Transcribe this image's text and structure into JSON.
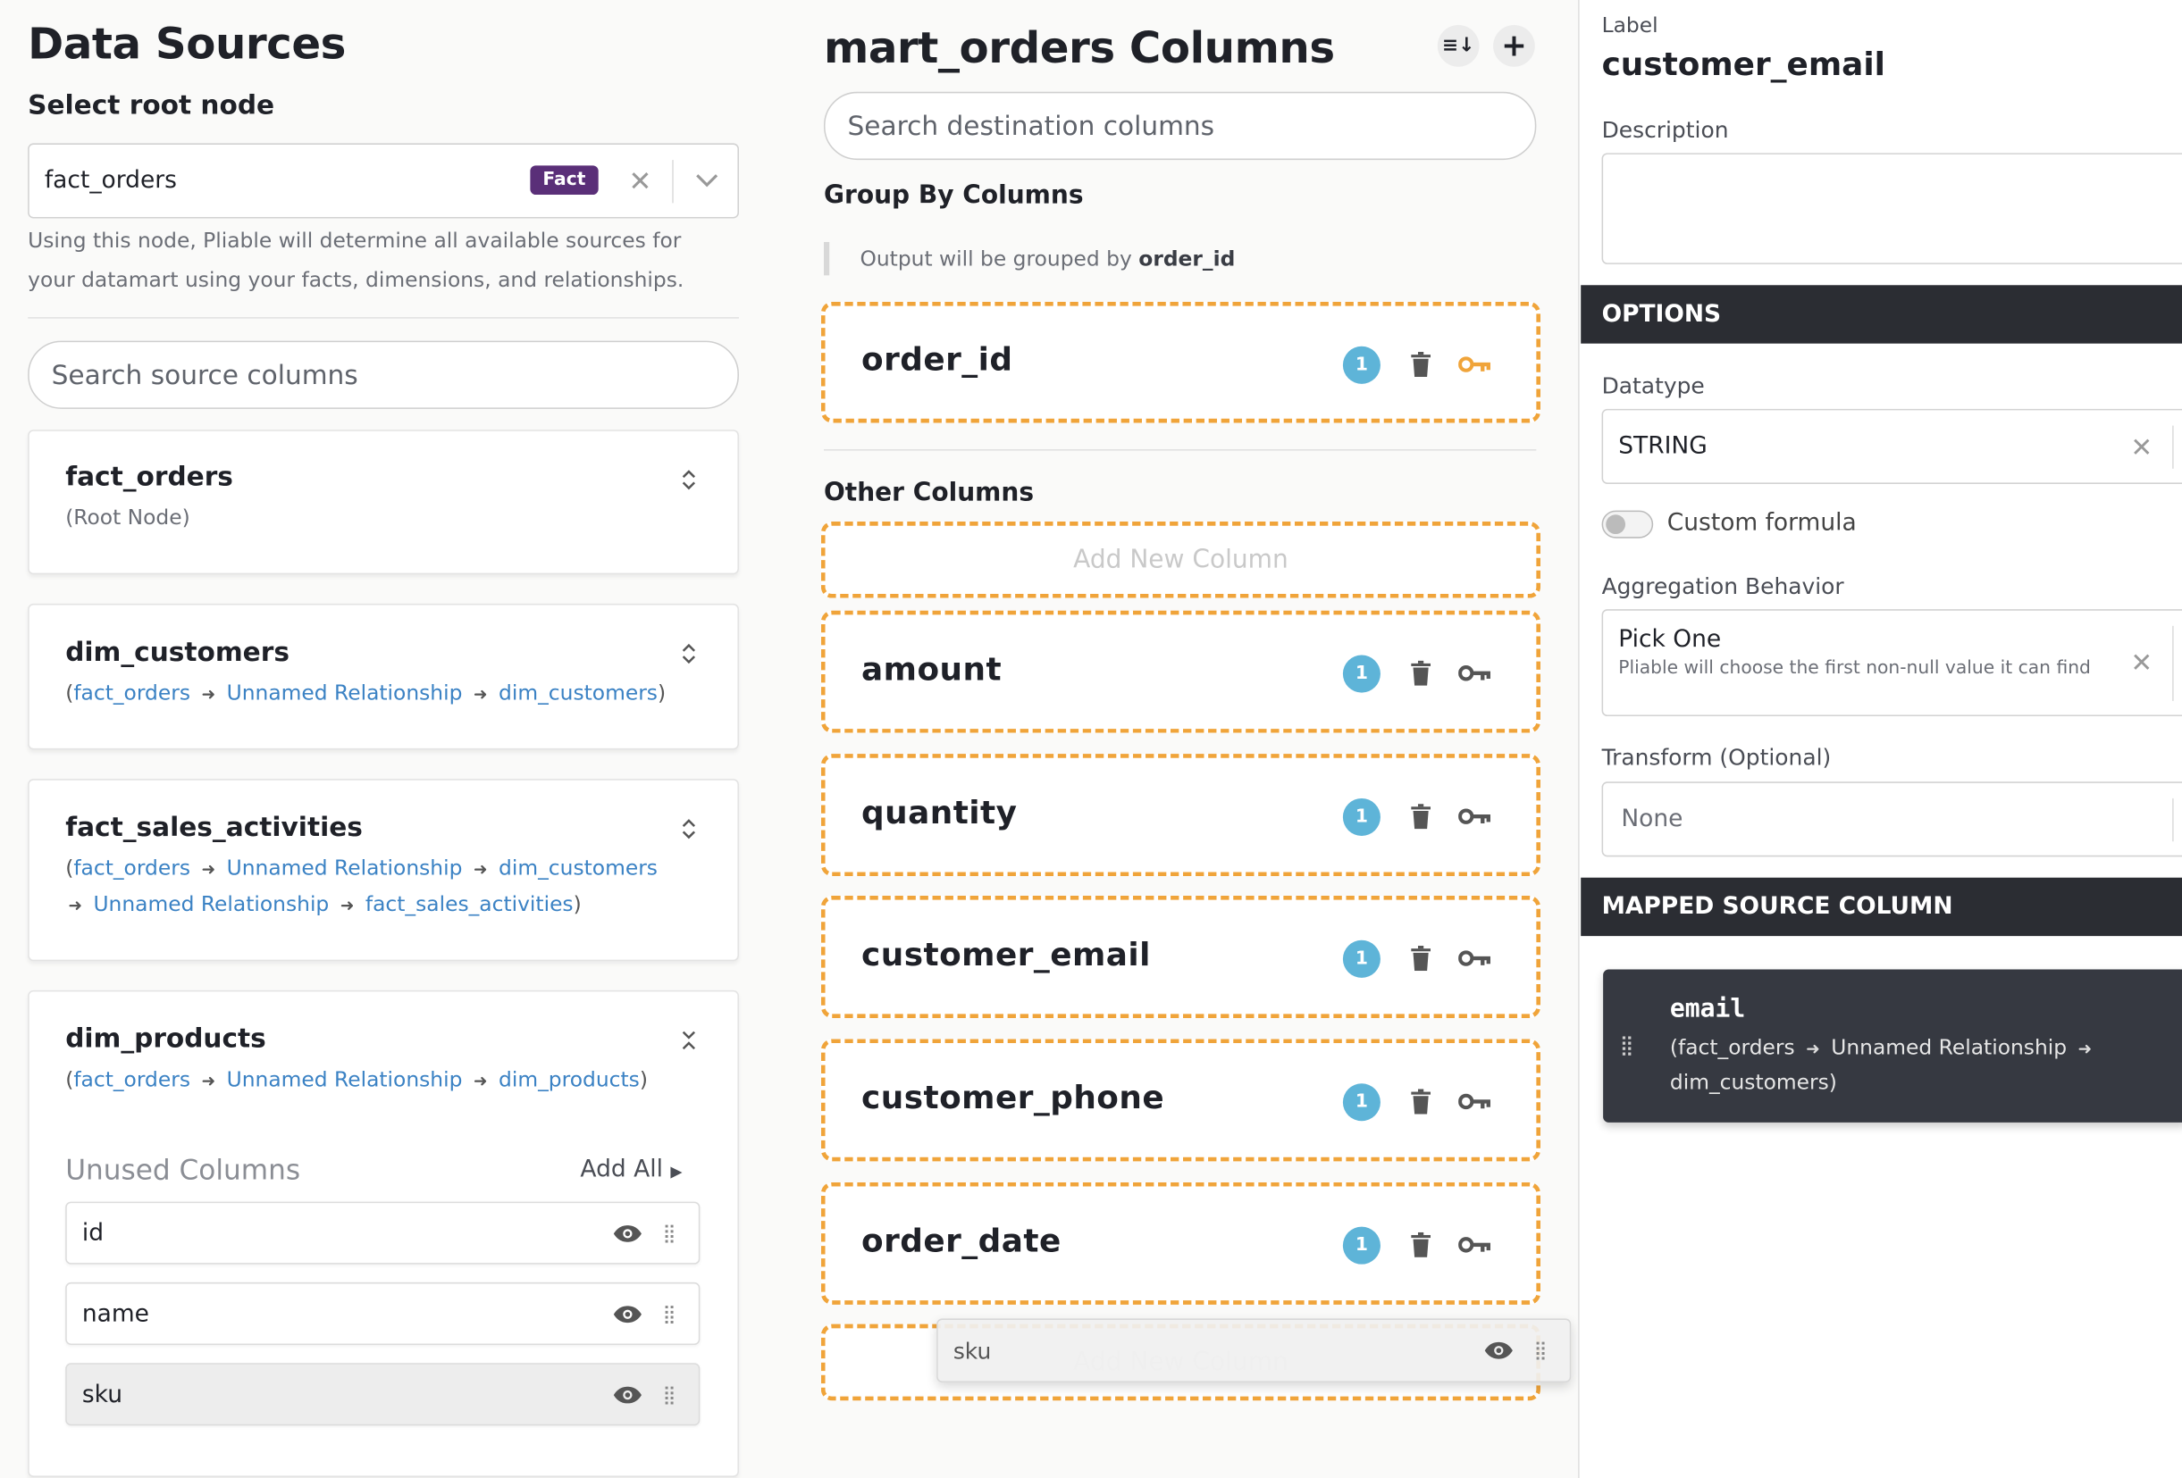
{
  "left": {
    "title": "Data Sources",
    "root_label": "Select root node",
    "root_value": "fact_orders",
    "root_badge": "Fact",
    "root_help": "Using this node, Pliable will determine all available sources for your datamart using your facts, dimensions, and relationships.",
    "search_placeholder": "Search source columns",
    "sources": [
      {
        "name": "fact_orders",
        "sub": "(Root Node)"
      },
      {
        "name": "dim_customers",
        "path": [
          "fact_orders",
          "Unnamed Relationship",
          "dim_customers"
        ]
      },
      {
        "name": "fact_sales_activities",
        "path": [
          "fact_orders",
          "Unnamed Relationship",
          "dim_customers",
          "Unnamed Relationship",
          "fact_sales_activities"
        ]
      },
      {
        "name": "dim_products",
        "path": [
          "fact_orders",
          "Unnamed Relationship",
          "dim_products"
        ]
      }
    ],
    "unused_label": "Unused Columns",
    "add_all": "Add All",
    "unused_columns": [
      "id",
      "name",
      "sku"
    ]
  },
  "middle": {
    "title": "mart_orders Columns",
    "search_placeholder": "Search destination columns",
    "group_title": "Group By Columns",
    "group_note_prefix": "Output will be grouped by",
    "group_note_value": "order_id",
    "group_columns": [
      {
        "name": "order_id",
        "count": "1",
        "key": true
      }
    ],
    "other_title": "Other Columns",
    "add_new": "Add New Column",
    "other_columns": [
      {
        "name": "amount",
        "count": "1"
      },
      {
        "name": "quantity",
        "count": "1"
      },
      {
        "name": "customer_email",
        "count": "1"
      },
      {
        "name": "customer_phone",
        "count": "1"
      },
      {
        "name": "order_date",
        "count": "1"
      }
    ],
    "drag_ghost": "sku",
    "drop_placeholder": "Add New Column"
  },
  "right": {
    "label_caption": "Label",
    "label_value": "customer_email",
    "description_caption": "Description",
    "description_value": "",
    "options_title": "OPTIONS",
    "datatype_caption": "Datatype",
    "datatype_value": "STRING",
    "custom_formula": "Custom formula",
    "aggregation_caption": "Aggregation Behavior",
    "aggregation_value": "Pick One",
    "aggregation_help": "Pliable will choose the first non-null value it can find",
    "transform_caption": "Transform (Optional)",
    "transform_value": "None",
    "mapped_title": "MAPPED SOURCE COLUMN",
    "mapped_name": "email",
    "mapped_path_line1": "(fact_orders",
    "mapped_path_rel": "Unnamed Relationship",
    "mapped_path_line2": "dim_customers)"
  },
  "colors": {
    "accent": "#f0a43a",
    "badge": "#5eb4d8",
    "fact_badge": "#5a2f78",
    "link": "#3b82c4",
    "dark_bar": "#2b2d33",
    "key_active": "#f0a43a"
  }
}
